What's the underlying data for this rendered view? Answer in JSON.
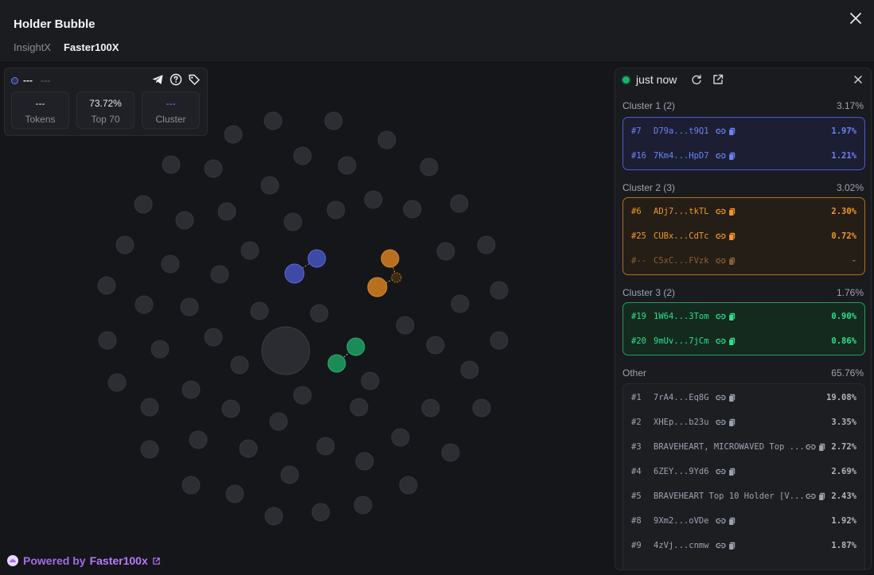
{
  "header": {
    "title": "Holder Bubble",
    "tabs": [
      {
        "label": "InsightX",
        "active": false
      },
      {
        "label": "Faster100X",
        "active": true
      }
    ]
  },
  "token_card": {
    "name": "---",
    "symbol": "---",
    "stats": [
      {
        "value": "---",
        "label": "Tokens"
      },
      {
        "value": "73.72%",
        "label": "Top 70"
      },
      {
        "value": "---",
        "label": "Cluster"
      }
    ]
  },
  "footer": {
    "prefix": "Powered by",
    "brand": "Faster100x"
  },
  "panel": {
    "status": "just now",
    "sections": [
      {
        "label": "Cluster 1 (2)",
        "pct": "3.17%",
        "theme": "blue",
        "rows": [
          {
            "rank": "#7",
            "addr": "D79a...t9Q1",
            "pct": "1.97%"
          },
          {
            "rank": "#16",
            "addr": "7Km4...HpD7",
            "pct": "1.21%"
          }
        ]
      },
      {
        "label": "Cluster 2 (3)",
        "pct": "3.02%",
        "theme": "orange",
        "rows": [
          {
            "rank": "#6",
            "addr": "ADj7...tkTL",
            "pct": "2.30%"
          },
          {
            "rank": "#25",
            "addr": "CUBx...CdTc",
            "pct": "0.72%"
          },
          {
            "rank": "#--",
            "addr": "C5xC...FVzk",
            "pct": "-",
            "dim": true
          }
        ]
      },
      {
        "label": "Cluster 3 (2)",
        "pct": "1.76%",
        "theme": "green",
        "rows": [
          {
            "rank": "#19",
            "addr": "1W64...3Tom",
            "pct": "0.90%"
          },
          {
            "rank": "#20",
            "addr": "9mUv...7jCm",
            "pct": "0.86%"
          }
        ]
      },
      {
        "label": "Other",
        "pct": "65.76%",
        "theme": "gray",
        "rows": [
          {
            "rank": "#1",
            "addr": "7rA4...Eq8G",
            "pct": "19.08%"
          },
          {
            "rank": "#2",
            "addr": "XHEp...b23u",
            "pct": "3.35%"
          },
          {
            "rank": "#3",
            "addr": "BRAVEHEART, MICROWAVED Top ...",
            "pct": "2.72%"
          },
          {
            "rank": "#4",
            "addr": "6ZEY...9Yd6",
            "pct": "2.69%"
          },
          {
            "rank": "#5",
            "addr": "BRAVEHEART Top 10 Holder [V...",
            "pct": "2.43%"
          },
          {
            "rank": "#8",
            "addr": "9Xm2...oVDe",
            "pct": "1.92%"
          },
          {
            "rank": "#9",
            "addr": "4zVj...cnmw",
            "pct": "1.87%"
          }
        ]
      }
    ]
  },
  "bubble_colors": {
    "neutral": "#2c2e34",
    "cluster1": "#3f4aa8",
    "cluster2": "#b8701e",
    "cluster3": "#1d8b57"
  }
}
